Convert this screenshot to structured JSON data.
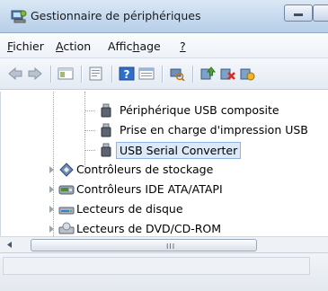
{
  "window": {
    "title": "Gestionnaire de périphériques",
    "accent": "#c9dcef"
  },
  "menu": {
    "items": [
      {
        "underline": "F",
        "rest": "ichier"
      },
      {
        "underline": "A",
        "rest": "ction"
      },
      {
        "pre": "Affic",
        "underline": "h",
        "rest": "age"
      },
      {
        "underline": "?",
        "rest": ""
      }
    ]
  },
  "toolbar": {
    "buttons": [
      "back-icon",
      "forward-icon",
      "console-tree-icon",
      "properties-icon",
      "help-icon",
      "show-hide-icon",
      "scan-hardware-icon",
      "update-driver-icon",
      "uninstall-icon",
      "disable-icon"
    ]
  },
  "tree": {
    "items": [
      {
        "label": "Périphérique USB composite",
        "icon": "usb-plug-icon",
        "level": 2
      },
      {
        "label": "Prise en charge d'impression USB",
        "icon": "usb-plug-icon",
        "level": 2
      },
      {
        "label": "USB Serial Converter",
        "icon": "usb-plug-icon",
        "level": 2,
        "selected": true
      },
      {
        "label": "Contrôleurs de stockage",
        "icon": "storage-controller-icon",
        "level": 1
      },
      {
        "label": "Contrôleurs IDE ATA/ATAPI",
        "icon": "ide-controller-icon",
        "level": 1
      },
      {
        "label": "Lecteurs de disque",
        "icon": "disk-drive-icon",
        "level": 1
      },
      {
        "label": "Lecteurs de DVD/CD-ROM",
        "icon": "dvd-drive-icon",
        "level": 1
      }
    ]
  },
  "scrollbar": {
    "grip": "III"
  }
}
